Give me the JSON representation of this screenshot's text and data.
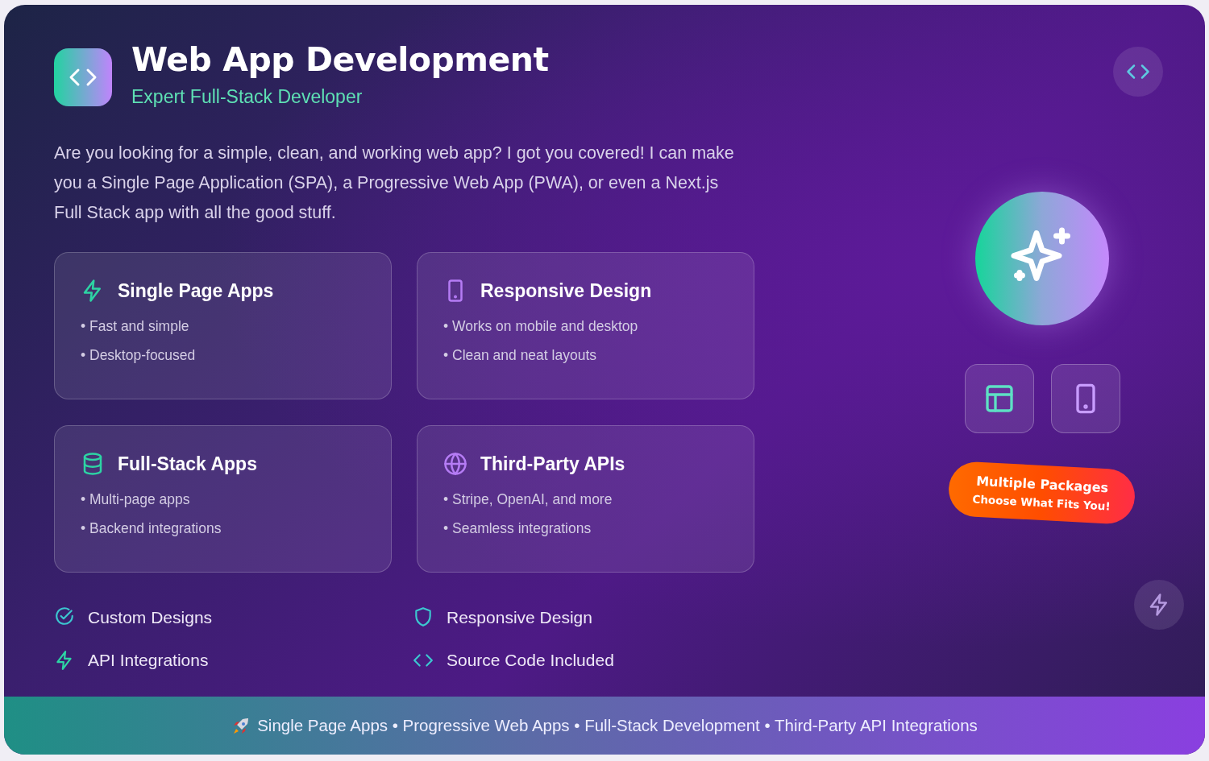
{
  "header": {
    "title": "Web App Development",
    "subtitle": "Expert Full-Stack Developer"
  },
  "intro": "Are you looking for a simple, clean, and working web app? I got you covered! I can make you a Single Page Application (SPA), a Progressive Web App (PWA), or even a Next.js Full Stack app with all the good stuff.",
  "cards": [
    {
      "kind": "bolt",
      "title": "Single Page Apps",
      "points": [
        "• Fast and simple",
        "• Desktop-focused"
      ]
    },
    {
      "kind": "phone",
      "title": "Responsive Design",
      "points": [
        "• Works on mobile and desktop",
        "• Clean and neat layouts"
      ]
    },
    {
      "kind": "database",
      "title": "Full-Stack Apps",
      "points": [
        "• Multi-page apps",
        "• Backend integrations"
      ]
    },
    {
      "kind": "globe",
      "title": "Third-Party APIs",
      "points": [
        "• Stripe, OpenAI, and more",
        "• Seamless integrations"
      ]
    }
  ],
  "features": [
    {
      "kind": "check",
      "label": "Custom Designs"
    },
    {
      "kind": "shield",
      "label": "Responsive Design"
    },
    {
      "kind": "bolt",
      "label": "API Integrations"
    },
    {
      "kind": "code",
      "label": "Source Code Included"
    }
  ],
  "badge": {
    "title": "Multiple Packages",
    "subtitle": "Choose What Fits You!"
  },
  "footer": "Single Page Apps • Progressive Web Apps • Full-Stack Development • Third-Party API Integrations"
}
